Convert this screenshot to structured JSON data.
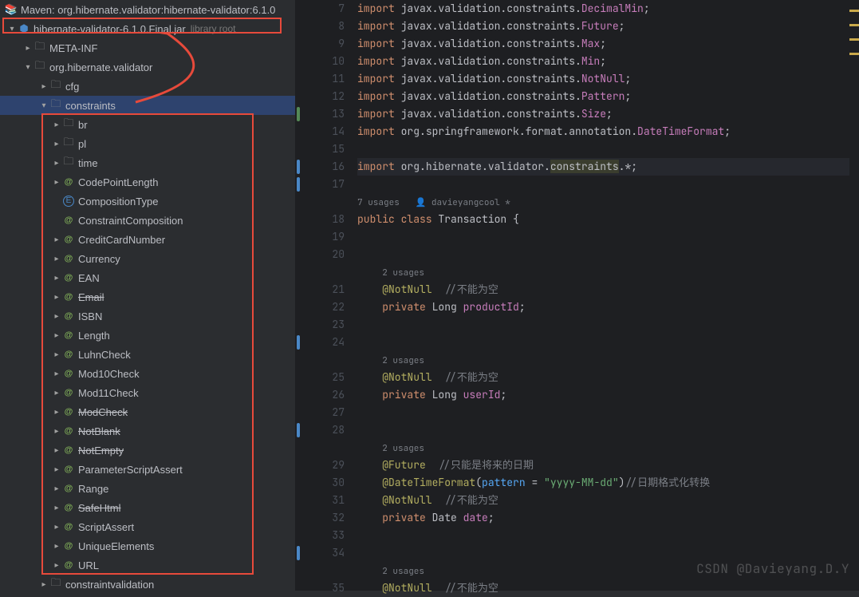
{
  "sidebar": {
    "maven_label": "Maven: org.hibernate.validator:hibernate-validator:6.1.0",
    "jar_label": "hibernate-validator-6.1.0.Final.jar",
    "jar_tag": "library root",
    "meta_inf": "META-INF",
    "pkg_root": "org.hibernate.validator",
    "cfg": "cfg",
    "constraints": "constraints",
    "constraintvalidation": "constraintvalidation",
    "items": [
      {
        "label": "br",
        "kind": "folder",
        "expandable": true
      },
      {
        "label": "pl",
        "kind": "folder",
        "expandable": true
      },
      {
        "label": "time",
        "kind": "folder",
        "expandable": true
      },
      {
        "label": "CodePointLength",
        "kind": "annotation",
        "expandable": true
      },
      {
        "label": "CompositionType",
        "kind": "enum",
        "expandable": false
      },
      {
        "label": "ConstraintComposition",
        "kind": "annotation",
        "expandable": false
      },
      {
        "label": "CreditCardNumber",
        "kind": "annotation",
        "expandable": true
      },
      {
        "label": "Currency",
        "kind": "annotation",
        "expandable": true
      },
      {
        "label": "EAN",
        "kind": "annotation",
        "expandable": true
      },
      {
        "label": "Email",
        "kind": "annotation",
        "expandable": true,
        "deprecated": true
      },
      {
        "label": "ISBN",
        "kind": "annotation",
        "expandable": true
      },
      {
        "label": "Length",
        "kind": "annotation",
        "expandable": true
      },
      {
        "label": "LuhnCheck",
        "kind": "annotation",
        "expandable": true
      },
      {
        "label": "Mod10Check",
        "kind": "annotation",
        "expandable": true
      },
      {
        "label": "Mod11Check",
        "kind": "annotation",
        "expandable": true
      },
      {
        "label": "ModCheck",
        "kind": "annotation",
        "expandable": true,
        "deprecated": true
      },
      {
        "label": "NotBlank",
        "kind": "annotation",
        "expandable": true,
        "deprecated": true
      },
      {
        "label": "NotEmpty",
        "kind": "annotation",
        "expandable": true,
        "deprecated": true
      },
      {
        "label": "ParameterScriptAssert",
        "kind": "annotation",
        "expandable": true
      },
      {
        "label": "Range",
        "kind": "annotation",
        "expandable": true
      },
      {
        "label": "SafeHtml",
        "kind": "annotation",
        "expandable": true,
        "deprecated": true
      },
      {
        "label": "ScriptAssert",
        "kind": "annotation",
        "expandable": true
      },
      {
        "label": "UniqueElements",
        "kind": "annotation",
        "expandable": true
      },
      {
        "label": "URL",
        "kind": "annotation",
        "expandable": true
      }
    ]
  },
  "editor": {
    "lines": [
      {
        "n": 7,
        "html": "<span class='kw'>import</span> javax.validation.constraints.<span class='cls'>DecimalMin</span>;"
      },
      {
        "n": 8,
        "html": "<span class='kw'>import</span> javax.validation.constraints.<span class='cls'>Future</span>;"
      },
      {
        "n": 9,
        "html": "<span class='kw'>import</span> javax.validation.constraints.<span class='cls'>Max</span>;"
      },
      {
        "n": 10,
        "html": "<span class='kw'>import</span> javax.validation.constraints.<span class='cls'>Min</span>;"
      },
      {
        "n": 11,
        "html": "<span class='kw'>import</span> javax.validation.constraints.<span class='cls'>NotNull</span>;"
      },
      {
        "n": 12,
        "html": "<span class='kw'>import</span> javax.validation.constraints.<span class='cls'>Pattern</span>;"
      },
      {
        "n": 13,
        "html": "<span class='kw'>import</span> javax.validation.constraints.<span class='cls'>Size</span>;"
      },
      {
        "n": 14,
        "html": "<span class='kw'>import</span> org.springframework.format.annotation.<span class='cls'>DateTimeFormat</span>;"
      },
      {
        "n": 15,
        "html": ""
      },
      {
        "n": 16,
        "html": "<span class='kw'>import</span> org.hibernate.validator.<span class='warn-token'>constraints</span>.*;",
        "hl": true
      },
      {
        "n": 17,
        "html": ""
      },
      {
        "n": null,
        "html": "<span class='usage-hint'>7 usages   👤 davieyangcool *</span>"
      },
      {
        "n": 18,
        "html": "<span class='kw'>public class</span> <span class='type'>Transaction</span> {"
      },
      {
        "n": 19,
        "html": ""
      },
      {
        "n": 20,
        "html": ""
      },
      {
        "n": null,
        "html": "    <span class='usage-hint'>2 usages</span>"
      },
      {
        "n": 21,
        "html": "    <span class='ann'>@NotNull</span>  <span class='comment'>//不能为空</span>"
      },
      {
        "n": 22,
        "html": "    <span class='kw'>private</span> Long <span class='field'>productId</span>;"
      },
      {
        "n": 23,
        "html": ""
      },
      {
        "n": 24,
        "html": ""
      },
      {
        "n": null,
        "html": "    <span class='usage-hint'>2 usages</span>"
      },
      {
        "n": 25,
        "html": "    <span class='ann'>@NotNull</span>  <span class='comment'>//不能为空</span>"
      },
      {
        "n": 26,
        "html": "    <span class='kw'>private</span> Long <span class='field'>userId</span>;"
      },
      {
        "n": 27,
        "html": ""
      },
      {
        "n": 28,
        "html": ""
      },
      {
        "n": null,
        "html": "    <span class='usage-hint'>2 usages</span>"
      },
      {
        "n": 29,
        "html": "    <span class='ann'>@Future</span>  <span class='comment'>//只能是将来的日期</span>"
      },
      {
        "n": 30,
        "html": "    <span class='ann'>@DateTimeFormat</span>(<span class='method'>pattern</span> = <span class='str'>\"yyyy-MM-dd\"</span>)<span class='comment'>//日期格式化转换</span>"
      },
      {
        "n": 31,
        "html": "    <span class='ann'>@NotNull</span>  <span class='comment'>//不能为空</span>"
      },
      {
        "n": 32,
        "html": "    <span class='kw'>private</span> Date <span class='field'>date</span>;"
      },
      {
        "n": 33,
        "html": ""
      },
      {
        "n": 34,
        "html": ""
      },
      {
        "n": null,
        "html": "    <span class='usage-hint'>2 usages</span>"
      },
      {
        "n": 35,
        "html": "    <span class='ann'>@NotNull</span>  <span class='comment'>//不能为空</span>"
      }
    ],
    "markers": [
      {
        "line": 13,
        "color": "#548a56"
      },
      {
        "line": 16,
        "color": "#4a88c7"
      },
      {
        "line": 17,
        "color": "#4a88c7"
      },
      {
        "line": 24,
        "color": "#4a88c7"
      },
      {
        "line": 28,
        "color": "#4a88c7"
      },
      {
        "line": 34,
        "color": "#4a88c7"
      }
    ]
  },
  "watermark": "CSDN @Davieyang.D.Y"
}
